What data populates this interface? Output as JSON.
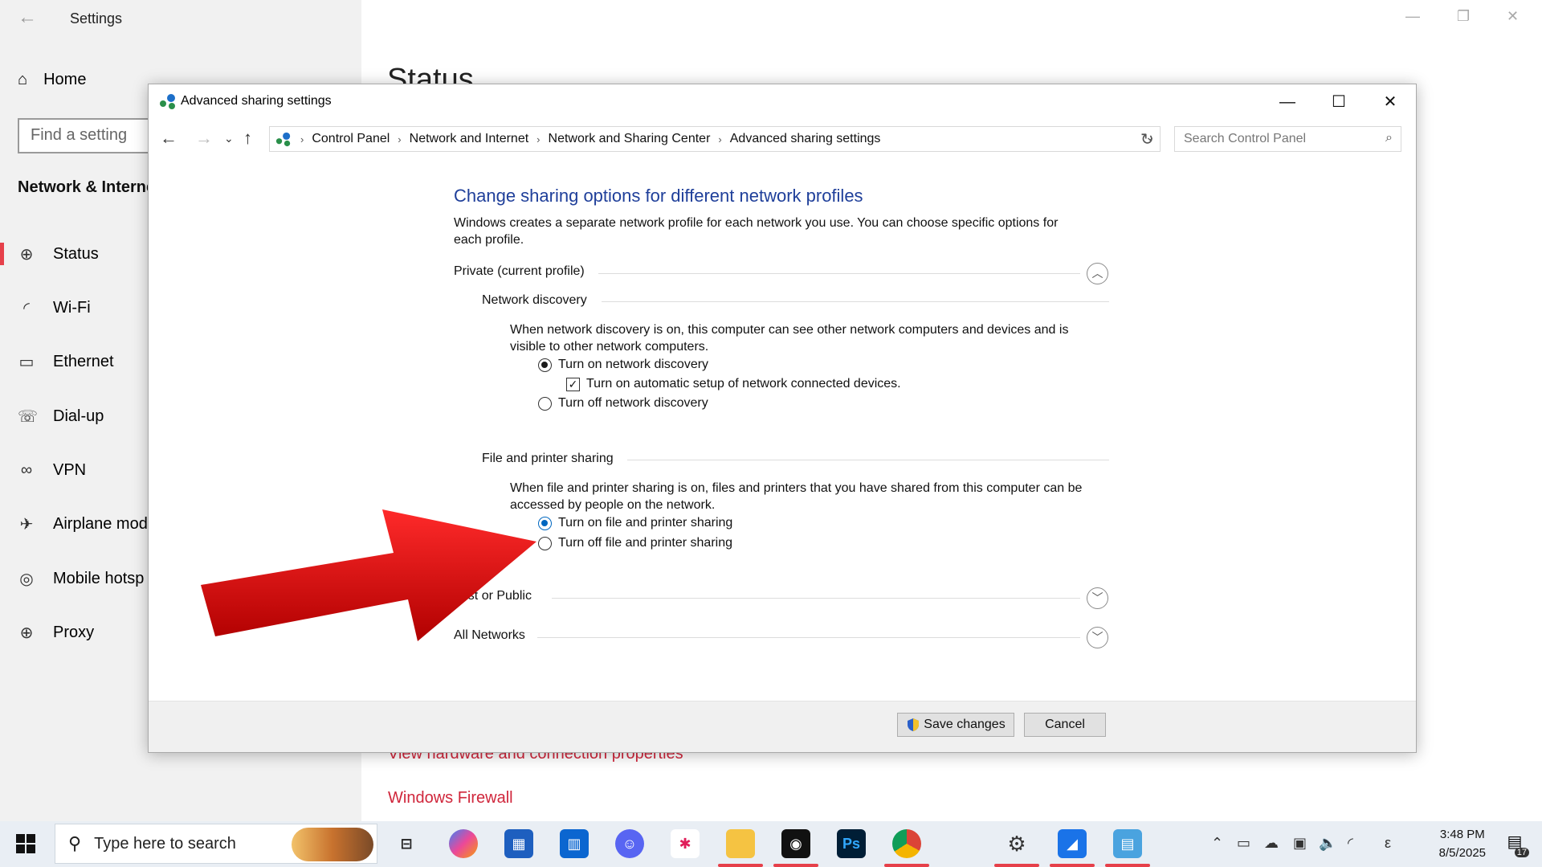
{
  "settings": {
    "window_title": "Settings",
    "home_label": "Home",
    "search_placeholder": "Find a setting",
    "section_title": "Network & Interne",
    "page_title": "Status",
    "nav_items": [
      {
        "label": "Status",
        "icon": "globe-icon"
      },
      {
        "label": "Wi-Fi",
        "icon": "wifi-icon"
      },
      {
        "label": "Ethernet",
        "icon": "ethernet-icon"
      },
      {
        "label": "Dial-up",
        "icon": "dialup-icon"
      },
      {
        "label": "VPN",
        "icon": "vpn-icon"
      },
      {
        "label": "Airplane mod",
        "icon": "airplane-icon"
      },
      {
        "label": "Mobile hotsp",
        "icon": "hotspot-icon"
      },
      {
        "label": "Proxy",
        "icon": "globe-icon"
      }
    ],
    "links": {
      "hardware": "View hardware and connection properties",
      "firewall": "Windows Firewall"
    }
  },
  "dialog": {
    "title": "Advanced sharing settings",
    "breadcrumbs": [
      "Control Panel",
      "Network and Internet",
      "Network and Sharing Center",
      "Advanced sharing settings"
    ],
    "search_placeholder": "Search Control Panel",
    "heading": "Change sharing options for different network profiles",
    "description": "Windows creates a separate network profile for each network you use. You can choose specific options for each profile.",
    "private_profile": "Private (current profile)",
    "network_discovery": {
      "title": "Network discovery",
      "description": "When network discovery is on, this computer can see other network computers and devices and is visible to other network computers.",
      "on_label": "Turn on network discovery",
      "auto_setup_label": "Turn on automatic setup of network connected devices.",
      "off_label": "Turn off network discovery"
    },
    "file_sharing": {
      "title": "File and printer sharing",
      "description": "When file and printer sharing is on, files and printers that you have shared from this computer can be accessed by people on the network.",
      "on_label": "Turn on file and printer sharing",
      "off_label": "Turn off file and printer sharing"
    },
    "guest_profile": "uest or Public",
    "all_networks": "All Networks",
    "save_label": "Save changes",
    "cancel_label": "Cancel"
  },
  "taskbar": {
    "search_placeholder": "Type here to search",
    "time": "3:48 PM",
    "date": "8/5/2025",
    "notification_count": "17",
    "tray_char": "ε"
  },
  "colors": {
    "accent_red": "#e6404a",
    "link_red": "#d0263b",
    "heading_blue": "#1f3f9a",
    "arrow_red": "#e0060e"
  }
}
